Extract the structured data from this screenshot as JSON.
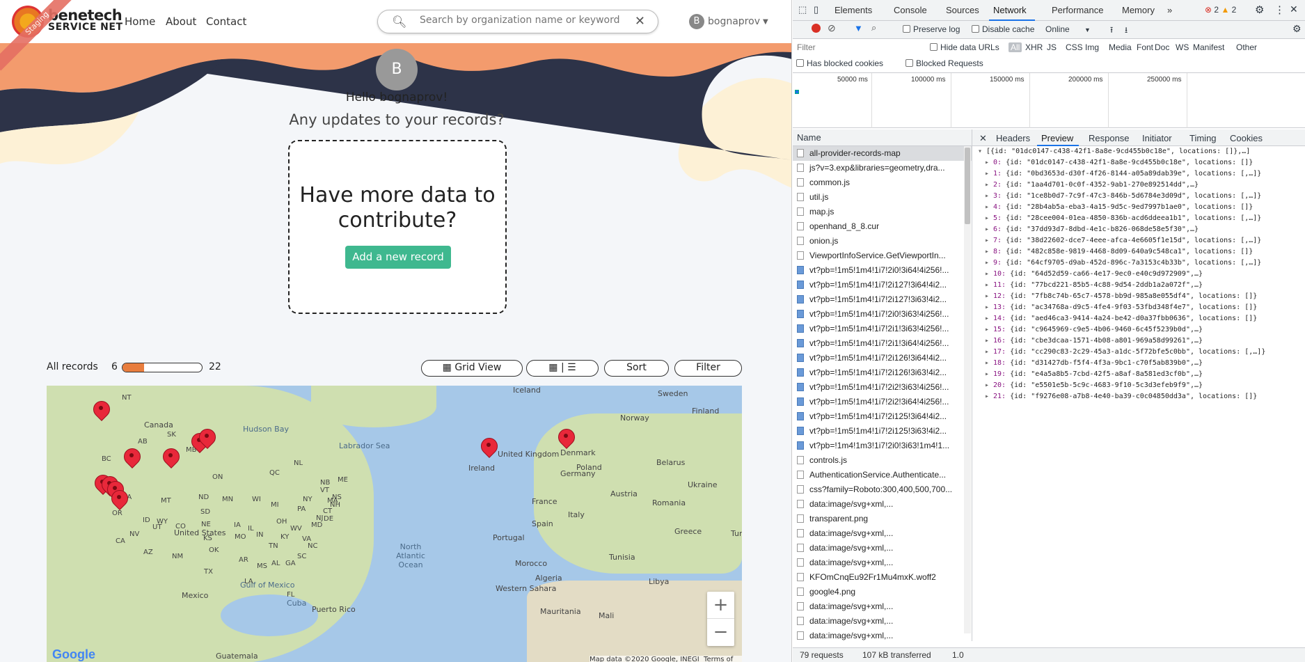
{
  "app": {
    "logo_line1": "benetech",
    "logo_line2": "SERVICE NET",
    "staging_label": "Staging",
    "nav": [
      "Home",
      "About",
      "Contact"
    ],
    "search_placeholder": "Search by organization name or keyword",
    "user_initial": "B",
    "user_name": "bognaprov",
    "greeting": "Hello bognaprov!",
    "subtitle": "Any updates to your records?",
    "contribute_text": "Have more data to contribute?",
    "add_record_label": "Add a new record",
    "all_records_label": "All records",
    "records_current": "6",
    "records_total": "22",
    "records_fraction": 0.27,
    "grid_view_label": "Grid View",
    "sort_label": "Sort",
    "filter_label": "Filter",
    "map_labels": [
      "Canada",
      "Hudson Bay",
      "Labrador Sea",
      "United States",
      "Mexico",
      "Gulf of Mexico",
      "North Atlantic Ocean",
      "Cuba",
      "Puerto Rico",
      "Ireland",
      "United Kingdom",
      "Denmark",
      "Poland",
      "Germany",
      "France",
      "Spain",
      "Portugal",
      "Italy",
      "Belarus",
      "Ukraine",
      "Romania",
      "Greece",
      "Morocco",
      "Algeria",
      "Libya",
      "Tunisia",
      "Sweden",
      "Finland",
      "Norway",
      "Iceland",
      "Austria",
      "Western Sahara",
      "Mauritania",
      "Mali",
      "Turk",
      "Guatemala",
      "NT",
      "BC",
      "AB",
      "SK",
      "MB",
      "ON",
      "QC",
      "NL",
      "WA",
      "MT",
      "ND",
      "MN",
      "ID",
      "WY",
      "SD",
      "NE",
      "IA",
      "UT",
      "CO",
      "KS",
      "MO",
      "CA",
      "NV",
      "AZ",
      "NM",
      "OK",
      "TX",
      "AR",
      "LA",
      "MS",
      "AL",
      "GA",
      "FL",
      "TN",
      "KY",
      "IN",
      "IL",
      "WI",
      "MI",
      "OH",
      "PA",
      "NY",
      "VA",
      "NC",
      "SC",
      "ME",
      "NS",
      "NB",
      "WV",
      "MD",
      "NJ",
      "CT",
      "MA",
      "VT",
      "NH",
      "DE",
      "OR"
    ],
    "zoom_in": "+",
    "zoom_out": "−",
    "google_logo": "Google",
    "map_attribution": "Map data ©2020 Google, INEGI",
    "terms": "Terms of Use"
  },
  "devtools": {
    "tabs": [
      "Elements",
      "Console",
      "Sources",
      "Network",
      "Performance",
      "Memory"
    ],
    "active_tab": "Network",
    "more_tabs": "»",
    "errors": "2",
    "warnings": "2",
    "preserve_log": "Preserve log",
    "disable_cache": "Disable cache",
    "throttle": "Online",
    "filter_placeholder": "Filter",
    "hide_data_urls": "Hide data URLs",
    "type_filters": [
      "All",
      "XHR",
      "JS",
      "CSS",
      "Img",
      "Media",
      "Font",
      "Doc",
      "WS",
      "Manifest",
      "Other"
    ],
    "has_blocked_cookies": "Has blocked cookies",
    "blocked_requests": "Blocked Requests",
    "timeline_ticks": [
      "50000 ms",
      "100000 ms",
      "150000 ms",
      "200000 ms",
      "250000 ms"
    ],
    "name_header": "Name",
    "requests": [
      "all-provider-records-map",
      "js?v=3.exp&libraries=geometry,dra...",
      "common.js",
      "util.js",
      "map.js",
      "openhand_8_8.cur",
      "onion.js",
      "ViewportInfoService.GetViewportIn...",
      "vt?pb=!1m5!1m4!1i7!2i0!3i64!4i256!...",
      "vt?pb=!1m5!1m4!1i7!2i127!3i64!4i2...",
      "vt?pb=!1m5!1m4!1i7!2i127!3i63!4i2...",
      "vt?pb=!1m5!1m4!1i7!2i0!3i63!4i256!...",
      "vt?pb=!1m5!1m4!1i7!2i1!3i63!4i256!...",
      "vt?pb=!1m5!1m4!1i7!2i1!3i64!4i256!...",
      "vt?pb=!1m5!1m4!1i7!2i126!3i64!4i2...",
      "vt?pb=!1m5!1m4!1i7!2i126!3i63!4i2...",
      "vt?pb=!1m5!1m4!1i7!2i2!3i63!4i256!...",
      "vt?pb=!1m5!1m4!1i7!2i2!3i64!4i256!...",
      "vt?pb=!1m5!1m4!1i7!2i125!3i64!4i2...",
      "vt?pb=!1m5!1m4!1i7!2i125!3i63!4i2...",
      "vt?pb=!1m4!1m3!1i7!2i0!3i63!1m4!1...",
      "controls.js",
      "AuthenticationService.Authenticate...",
      "css?family=Roboto:300,400,500,700...",
      "data:image/svg+xml,...",
      "transparent.png",
      "data:image/svg+xml,...",
      "data:image/svg+xml,...",
      "data:image/svg+xml,...",
      "KFOmCnqEu92Fr1Mu4mxK.woff2",
      "google4.png",
      "data:image/svg+xml,...",
      "data:image/svg+xml,...",
      "data:image/svg+xml,..."
    ],
    "detail_tabs": [
      "Headers",
      "Preview",
      "Response",
      "Initiator",
      "Timing",
      "Cookies"
    ],
    "active_detail_tab": "Preview",
    "preview_root": "[{id: \"01dc0147-c438-42f1-8a8e-9cd455b0c18e\", locations: []},…]",
    "preview_rows": [
      "{id: \"01dc0147-c438-42f1-8a8e-9cd455b0c18e\", locations: []}",
      "{id: \"0bd3653d-d30f-4f26-8144-a05a89dab39e\", locations: [,…]}",
      "{id: \"1aa4d701-0c0f-4352-9ab1-270e892514dd\",…}",
      "{id: \"1ce8b0d7-7c9f-47c3-846b-5d6784e3d09d\", locations: [,…]}",
      "{id: \"28b4ab5a-eba3-4a15-9d5c-9ed7997b1ae0\", locations: []}",
      "{id: \"28cee004-01ea-4850-836b-acd6ddeea1b1\", locations: [,…]}",
      "{id: \"37dd93d7-8dbd-4e1c-b826-068de58e5f30\",…}",
      "{id: \"38d22602-dce7-4eee-afca-4e6605f1e15d\", locations: [,…]}",
      "{id: \"482c858e-9819-4468-8d09-640a9c548ca1\", locations: []}",
      "{id: \"64cf9705-d9ab-452d-896c-7a3153c4b33b\", locations: [,…]}",
      "{id: \"64d52d59-ca66-4e17-9ec0-e40c9d972909\",…}",
      "{id: \"77bcd221-85b5-4c88-9d54-2ddb1a2a072f\",…}",
      "{id: \"7fb8c74b-65c7-4578-bb9d-985a8e055df4\", locations: []}",
      "{id: \"ac34768a-d9c5-4fe4-9f03-53fbd348f4e7\", locations: []}",
      "{id: \"aed46ca3-9414-4a24-be42-d0a37fbb0636\", locations: []}",
      "{id: \"c9645969-c9e5-4b06-9460-6c45f5239b0d\",…}",
      "{id: \"cbe3dcaa-1571-4b08-a801-969a58d99261\",…}",
      "{id: \"cc290c83-2c29-45a3-a1dc-5f72bfe5c0bb\", locations: [,…]}",
      "{id: \"d31427db-f5f4-4f3a-9bc1-c70f5ab839b0\",…}",
      "{id: \"e4a5a8b5-7cbd-42f5-a8af-8a581ed3cf0b\",…}",
      "{id: \"e5501e5b-5c9c-4683-9f10-5c3d3efeb9f9\",…}",
      "{id: \"f9276e08-a7b8-4e40-ba39-c0c04850dd3a\", locations: []}"
    ],
    "status_requests": "79 requests",
    "status_transferred": "107 kB transferred",
    "status_extra": "1.0"
  },
  "colors": {
    "accent_green": "#3fb88f",
    "orange": "#f39b6d",
    "navy": "#2d3348",
    "pin_red": "#e8283a",
    "devtools_blue": "#1a73e8"
  }
}
